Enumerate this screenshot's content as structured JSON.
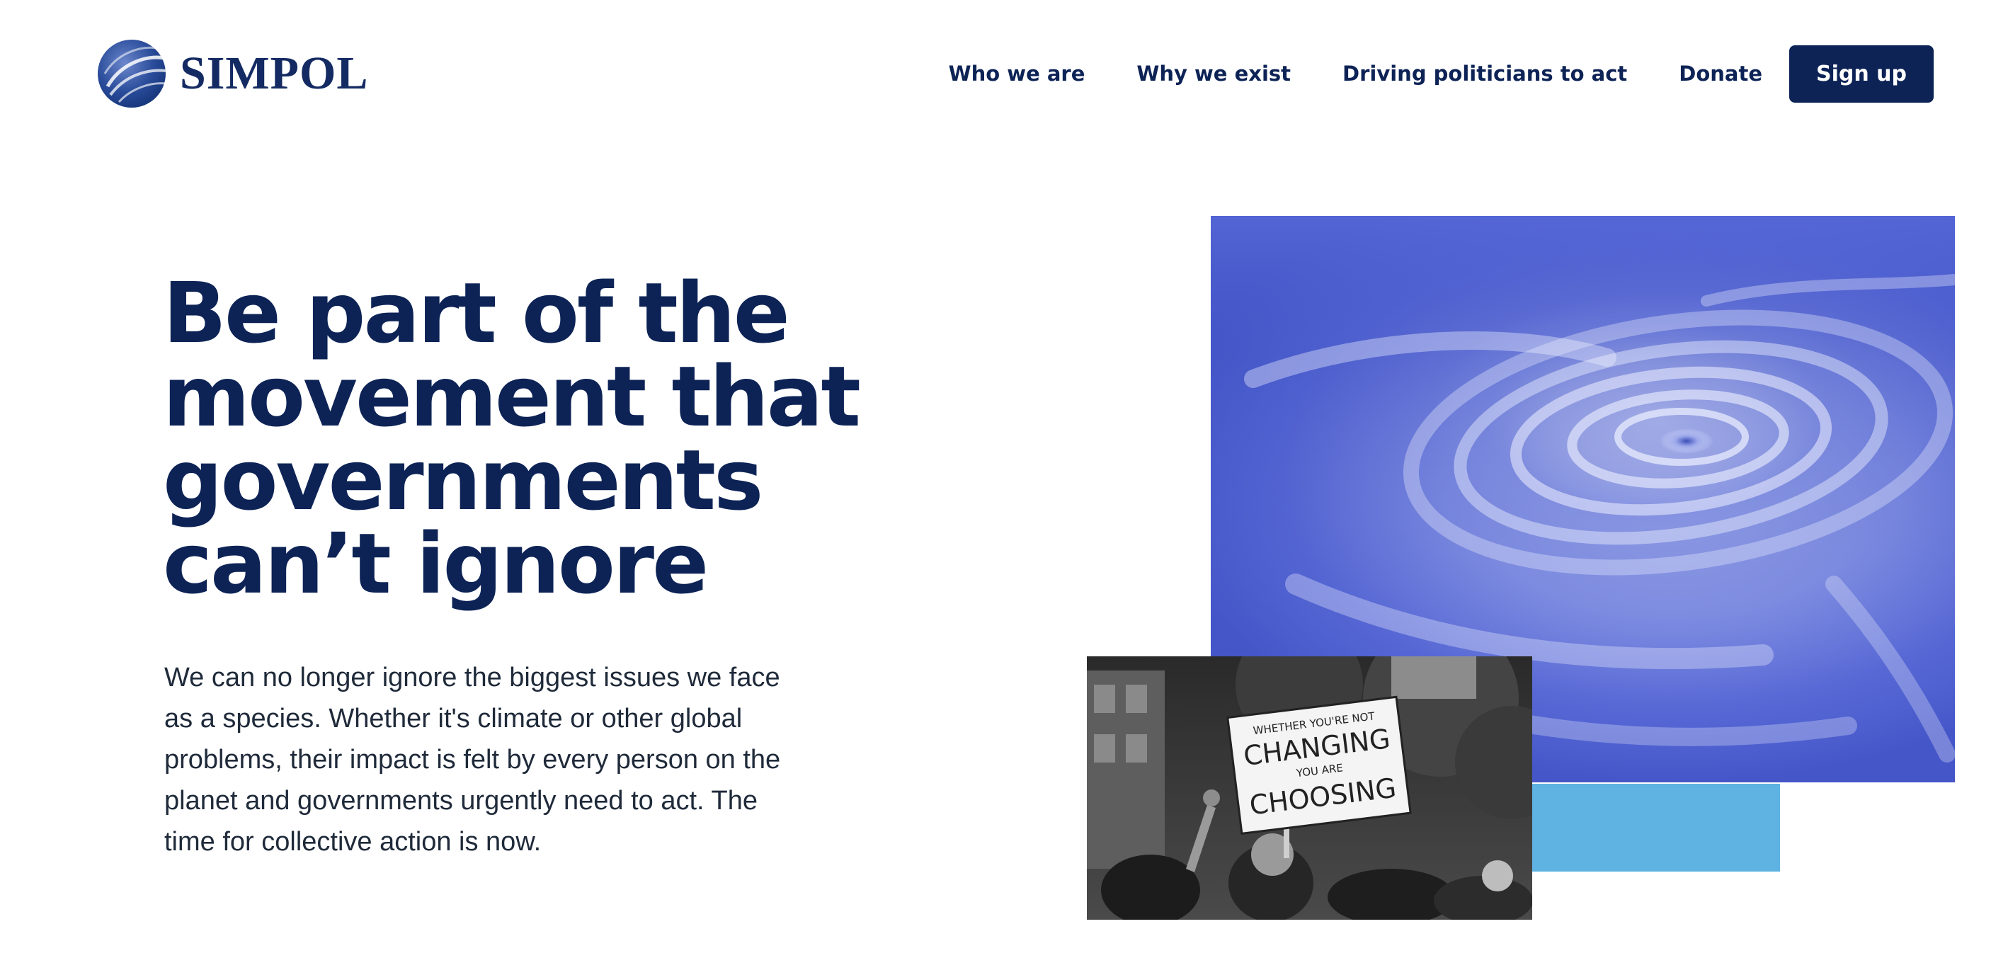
{
  "header": {
    "logo_text": "SIMPOL",
    "nav": {
      "who_we_are": "Who we are",
      "why_we_exist": "Why we exist",
      "driving_politicians": "Driving politicians to act",
      "donate": "Donate",
      "sign_up": "Sign up"
    }
  },
  "hero": {
    "title": "Be part of the\nmovement that\ngovernments\ncan’t ignore",
    "body": "We can no longer ignore the biggest issues we face\nas a species. Whether it's climate or other global\nproblems, their impact is felt by every person on the\nplanet and governments urgently need to act. The\ntime for collective action is now."
  },
  "images": {
    "hurricane": "hurricane-satellite-image",
    "protest": "climate-protest-photo",
    "protest_sign_lines": [
      "WHETHER YOU'RE NOT",
      "CHANGING",
      "YOU ARE",
      "CHOOSING"
    ]
  },
  "colors": {
    "brand_navy": "#0d2356",
    "accent_blue": "#5eb3e2",
    "background": "#ffffff"
  }
}
